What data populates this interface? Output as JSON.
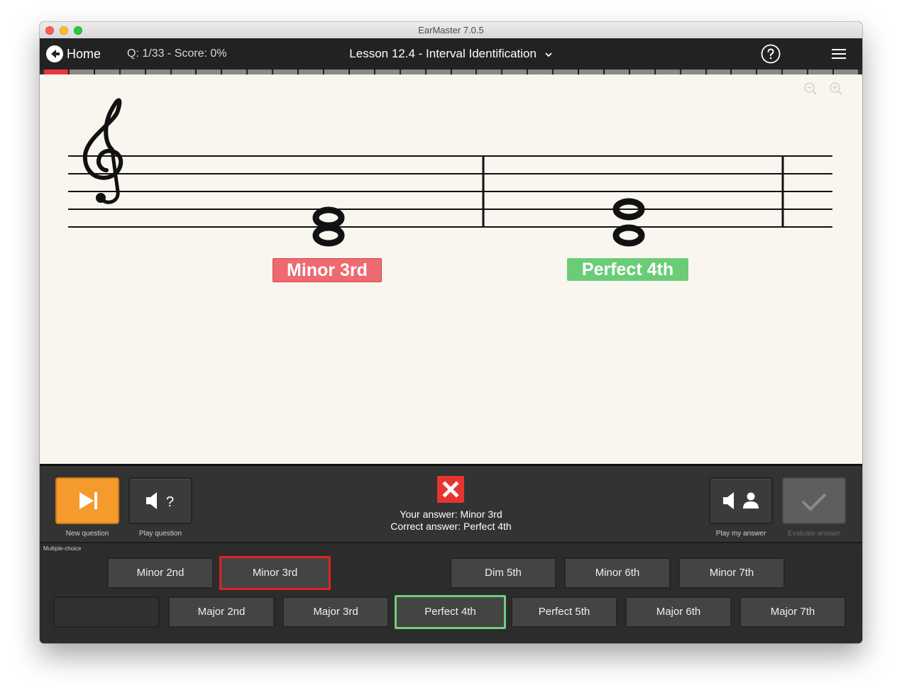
{
  "window": {
    "title": "EarMaster 7.0.5"
  },
  "navbar": {
    "home_label": "Home",
    "score_text": "Q: 1/33 - Score: 0%",
    "lesson_title": "Lesson 12.4 - Interval Identification",
    "progress": {
      "total_segments": 32,
      "current_index": 0
    }
  },
  "notation": {
    "clef": "treble",
    "intervals": [
      {
        "label": "Minor 3rd",
        "status": "wrong",
        "color": "#ed6a70"
      },
      {
        "label": "Perfect 4th",
        "status": "correct",
        "color": "#6bcc78"
      }
    ]
  },
  "controls": {
    "new_question": "New question",
    "play_question": "Play question",
    "play_my_answer": "Play my answer",
    "evaluate_answer": "Evaluate answer",
    "feedback": {
      "your_answer": "Your answer: Minor 3rd",
      "correct_answer": "Correct answer: Perfect 4th"
    }
  },
  "choices": {
    "section_label": "Multiple-choice",
    "row1": [
      "Minor 2nd",
      "Minor 3rd",
      "Dim 5th",
      "Minor 6th",
      "Minor 7th"
    ],
    "row2": [
      "Major 2nd",
      "Major 3rd",
      "Perfect 4th",
      "Perfect 5th",
      "Major 6th",
      "Major 7th"
    ]
  },
  "colors": {
    "accent_orange": "#f59a2c",
    "wrong_red": "#e0231f",
    "correct_green": "#6fcf7a",
    "progress_current": "#e8373f"
  }
}
